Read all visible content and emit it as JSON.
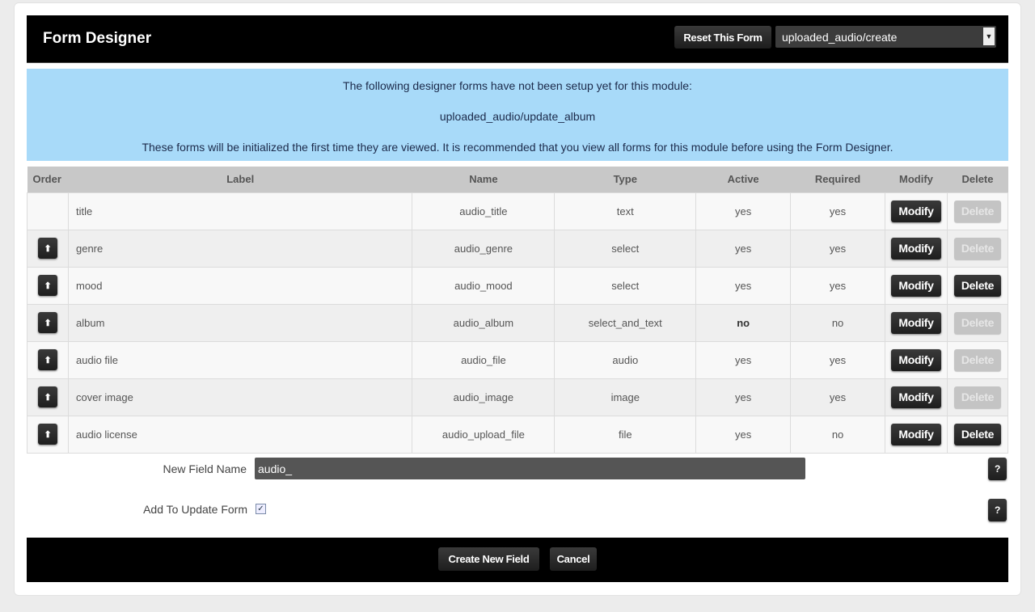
{
  "header": {
    "title": "Form Designer",
    "reset_label": "Reset This Form",
    "form_select": "uploaded_audio/create"
  },
  "info": {
    "line1": "The following designer forms have not been setup yet for this module:",
    "line2": "uploaded_audio/update_album",
    "line3": "These forms will be initialized the first time they are viewed. It is recommended that you view all forms for this module before using the Form Designer."
  },
  "table": {
    "headers": [
      "Order",
      "Label",
      "Name",
      "Type",
      "Active",
      "Required",
      "Modify",
      "Delete"
    ],
    "rows": [
      {
        "label": "title",
        "name": "audio_title",
        "type": "text",
        "active": "yes",
        "required": "yes",
        "modify": "Modify",
        "delete": "Delete",
        "order_button": false,
        "delete_enabled": false
      },
      {
        "label": "genre",
        "name": "audio_genre",
        "type": "select",
        "active": "yes",
        "required": "yes",
        "modify": "Modify",
        "delete": "Delete",
        "order_button": true,
        "delete_enabled": false
      },
      {
        "label": "mood",
        "name": "audio_mood",
        "type": "select",
        "active": "yes",
        "required": "yes",
        "modify": "Modify",
        "delete": "Delete",
        "order_button": true,
        "delete_enabled": true
      },
      {
        "label": "album",
        "name": "audio_album",
        "type": "select_and_text",
        "active": "no",
        "required": "no",
        "modify": "Modify",
        "delete": "Delete",
        "order_button": true,
        "delete_enabled": false
      },
      {
        "label": "audio file",
        "name": "audio_file",
        "type": "audio",
        "active": "yes",
        "required": "yes",
        "modify": "Modify",
        "delete": "Delete",
        "order_button": true,
        "delete_enabled": false
      },
      {
        "label": "cover image",
        "name": "audio_image",
        "type": "image",
        "active": "yes",
        "required": "yes",
        "modify": "Modify",
        "delete": "Delete",
        "order_button": true,
        "delete_enabled": false
      },
      {
        "label": "audio license",
        "name": "audio_upload_file",
        "type": "file",
        "active": "yes",
        "required": "no",
        "modify": "Modify",
        "delete": "Delete",
        "order_button": true,
        "delete_enabled": true
      }
    ]
  },
  "new_field": {
    "label": "New Field Name",
    "value": "audio_",
    "add_update_label": "Add To Update Form",
    "add_update_checked": true,
    "help": "?"
  },
  "footer": {
    "create_label": "Create New Field",
    "cancel_label": "Cancel"
  },
  "icons": {
    "order": "arrow-up-icon",
    "select": "chevron-down-icon"
  }
}
